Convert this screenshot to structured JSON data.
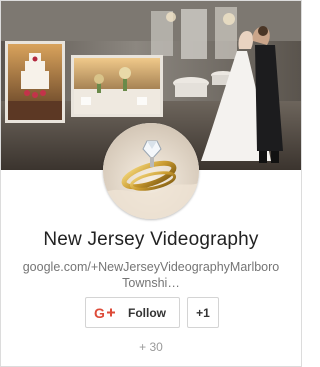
{
  "profile": {
    "name": "New Jersey Videography",
    "url_text": "google.com/+NewJerseyVideographyMarlboroTownshi…"
  },
  "actions": {
    "follow_label": "Follow",
    "plusone_label": "+1"
  },
  "followers": {
    "count_text": "+ 30"
  },
  "icons": {
    "gplus": "google-plus-icon"
  },
  "colors": {
    "gplus_red": "#dd4b39",
    "name_text": "#222222",
    "url_text": "#757575",
    "count_text": "#9a9a9a"
  }
}
